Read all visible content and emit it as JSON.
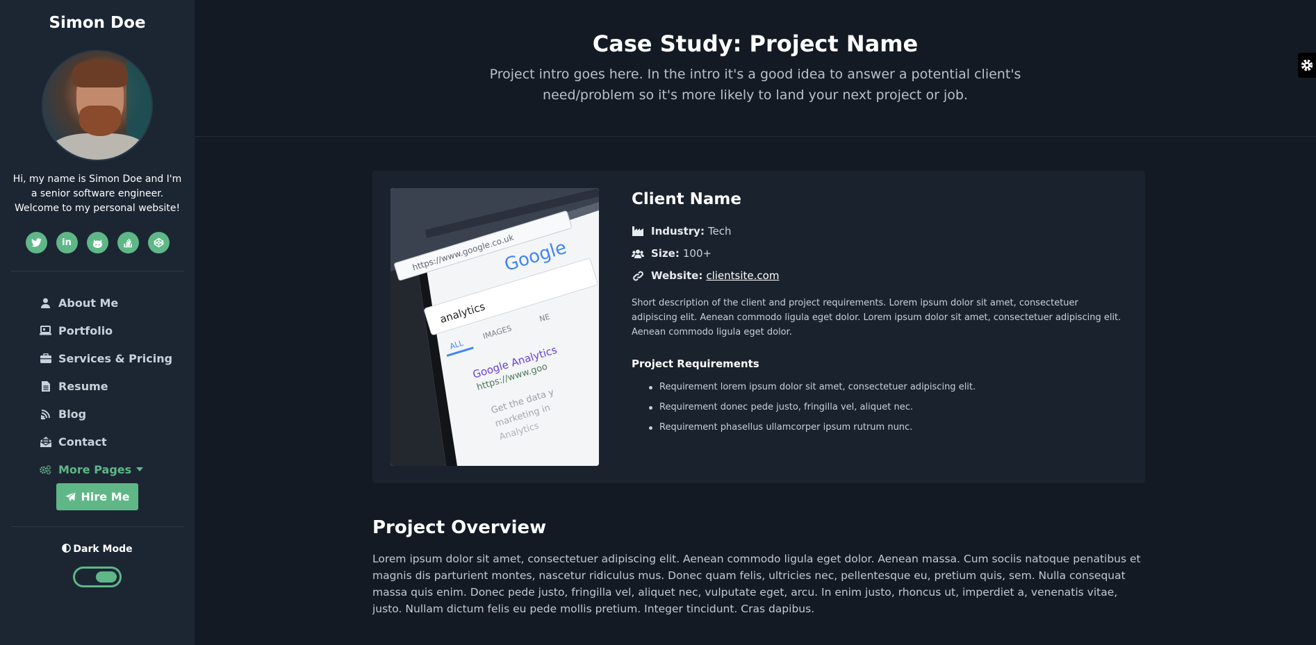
{
  "sidebar": {
    "brand": "Simon Doe",
    "intro": "Hi, my name is Simon Doe and I'm a senior software engineer. Welcome to my personal website!",
    "social": [
      {
        "icon": "twitter-icon",
        "glyph": "t"
      },
      {
        "icon": "linkedin-icon",
        "glyph": "in"
      },
      {
        "icon": "github-icon",
        "glyph": "gh"
      },
      {
        "icon": "stackoverflow-icon",
        "glyph": "so"
      },
      {
        "icon": "codepen-icon",
        "glyph": "cp"
      }
    ],
    "nav": [
      {
        "label": "About Me",
        "icon": "user-icon"
      },
      {
        "label": "Portfolio",
        "icon": "laptop-icon"
      },
      {
        "label": "Services & Pricing",
        "icon": "briefcase-icon"
      },
      {
        "label": "Resume",
        "icon": "file-icon"
      },
      {
        "label": "Blog",
        "icon": "blog-icon"
      },
      {
        "label": "Contact",
        "icon": "envelope-open-icon"
      },
      {
        "label": "More Pages",
        "icon": "cogs-icon"
      }
    ],
    "hire_label": "Hire Me",
    "dark_mode_label": "Dark Mode",
    "dark_mode_on": true
  },
  "header": {
    "title": "Case Study: Project Name",
    "intro": "Project intro goes here. In the intro it's a good idea to answer a potential client's need/problem so it's more likely to land your next project or job."
  },
  "client": {
    "name": "Client Name",
    "industry_label": "Industry:",
    "industry": "Tech",
    "size_label": "Size:",
    "size": "100+",
    "website_label": "Website:",
    "website": "clientsite.com",
    "description": "Short description of the client and project requirements. Lorem ipsum dolor sit amet, consectetuer adipiscing elit. Aenean commodo ligula eget dolor. Lorem ipsum dolor sit amet, consectetuer adipiscing elit. Aenean commodo ligula eget dolor.",
    "requirements_title": "Project Requirements",
    "requirements": [
      "Requirement lorem ipsum dolor sit amet, consectetuer adipiscing elit.",
      "Requirement donec pede justo, fringilla vel, aliquet nec.",
      "Requirement phasellus ullamcorper ipsum rutrum nunc."
    ]
  },
  "overview": {
    "title": "Project Overview",
    "text": "Lorem ipsum dolor sit amet, consectetuer adipiscing elit. Aenean commodo ligula eget dolor. Aenean massa. Cum sociis natoque penatibus et magnis dis parturient montes, nascetur ridiculus mus. Donec quam felis, ultricies nec, pellentesque eu, pretium quis, sem. Nulla consequat massa quis enim. Donec pede justo, fringilla vel, aliquet nec, vulputate eget, arcu. In enim justo, rhoncus ut, imperdiet a, venenatis vitae, justo. Nullam dictum felis eu pede mollis pretium. Integer tincidunt. Cras dapibus."
  },
  "photo": {
    "screen_text": {
      "url": "https://www.google.co.uk",
      "logo": "Google",
      "search": "analytics",
      "tab_all": "ALL",
      "tab_images": "IMAGES",
      "tab_news": "NE",
      "result_title": "Google Analytics",
      "result_url": "https://www.goo",
      "snippet_1": "Get the data y",
      "snippet_2": "marketing in",
      "snippet_3": "Analytics"
    }
  },
  "colors": {
    "accent": "#5fb787",
    "sidebar_bg": "#1c2633",
    "main_bg": "#141a23",
    "card_bg": "#1a222d"
  }
}
